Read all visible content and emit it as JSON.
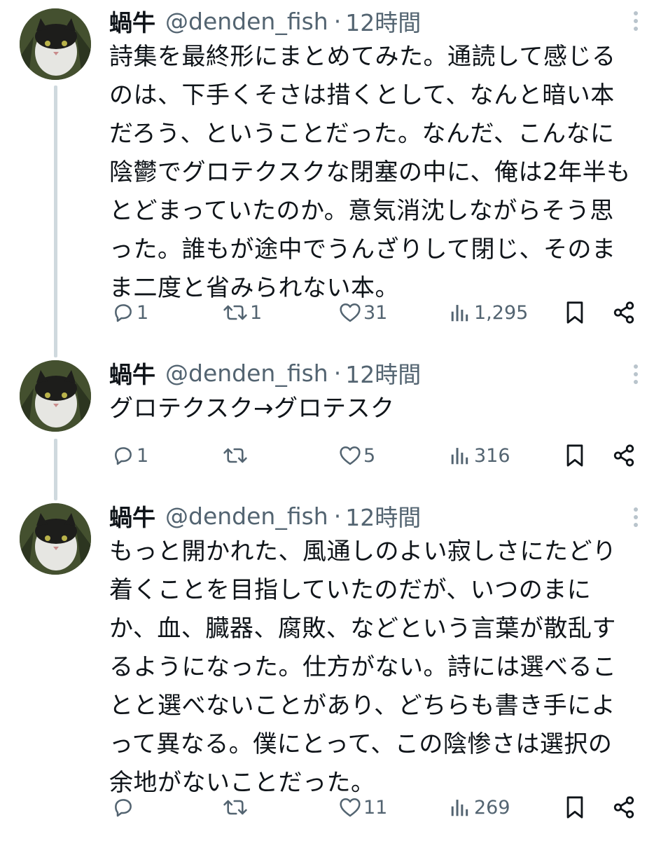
{
  "tweets": [
    {
      "name": "蝸牛",
      "handle": "@denden_fish",
      "dot": "·",
      "time": "12時間",
      "text": "詩集を最終形にまとめてみた。通読して感じる\nのは、下手くそさは措くとして、なんと暗い本\nだろう、ということだった。なんだ、こんなに\n陰鬱でグロテクスクな閉塞の中に、俺は2年半も\nとどまっていたのか。意気消沈しながらそう思\nった。誰もが途中でうんざりして閉じ、そのま\nま二度と省みられない本。",
      "stats": {
        "replies": "1",
        "retweets": "1",
        "likes": "31",
        "views": "1,295"
      }
    },
    {
      "name": "蝸牛",
      "handle": "@denden_fish",
      "dot": "·",
      "time": "12時間",
      "text": "グロテクスク→グロテスク",
      "stats": {
        "replies": "1",
        "retweets": "",
        "likes": "5",
        "views": "316"
      }
    },
    {
      "name": "蝸牛",
      "handle": "@denden_fish",
      "dot": "·",
      "time": "12時間",
      "text": "もっと開かれた、風通しのよい寂しさにたどり\n着くことを目指していたのだが、いつのまに\nか、血、臓器、腐敗、などという言葉が散乱す\nるようになった。仕方がない。詩には選べるこ\nとと選べないことがあり、どちらも書き手によ\nって異なる。僕にとって、この陰惨さは選択の\n余地がないことだった。",
      "stats": {
        "replies": "",
        "retweets": "",
        "likes": "11",
        "views": "269"
      }
    }
  ],
  "icons": {
    "reply": "reply-icon",
    "retweet": "retweet-icon",
    "like": "heart-icon",
    "views": "views-icon",
    "bookmark": "bookmark-icon",
    "share": "share-icon",
    "more": "more-icon"
  },
  "colors": {
    "text": "#0f1419",
    "secondary": "#536471",
    "thread_line": "#cfd9de"
  }
}
